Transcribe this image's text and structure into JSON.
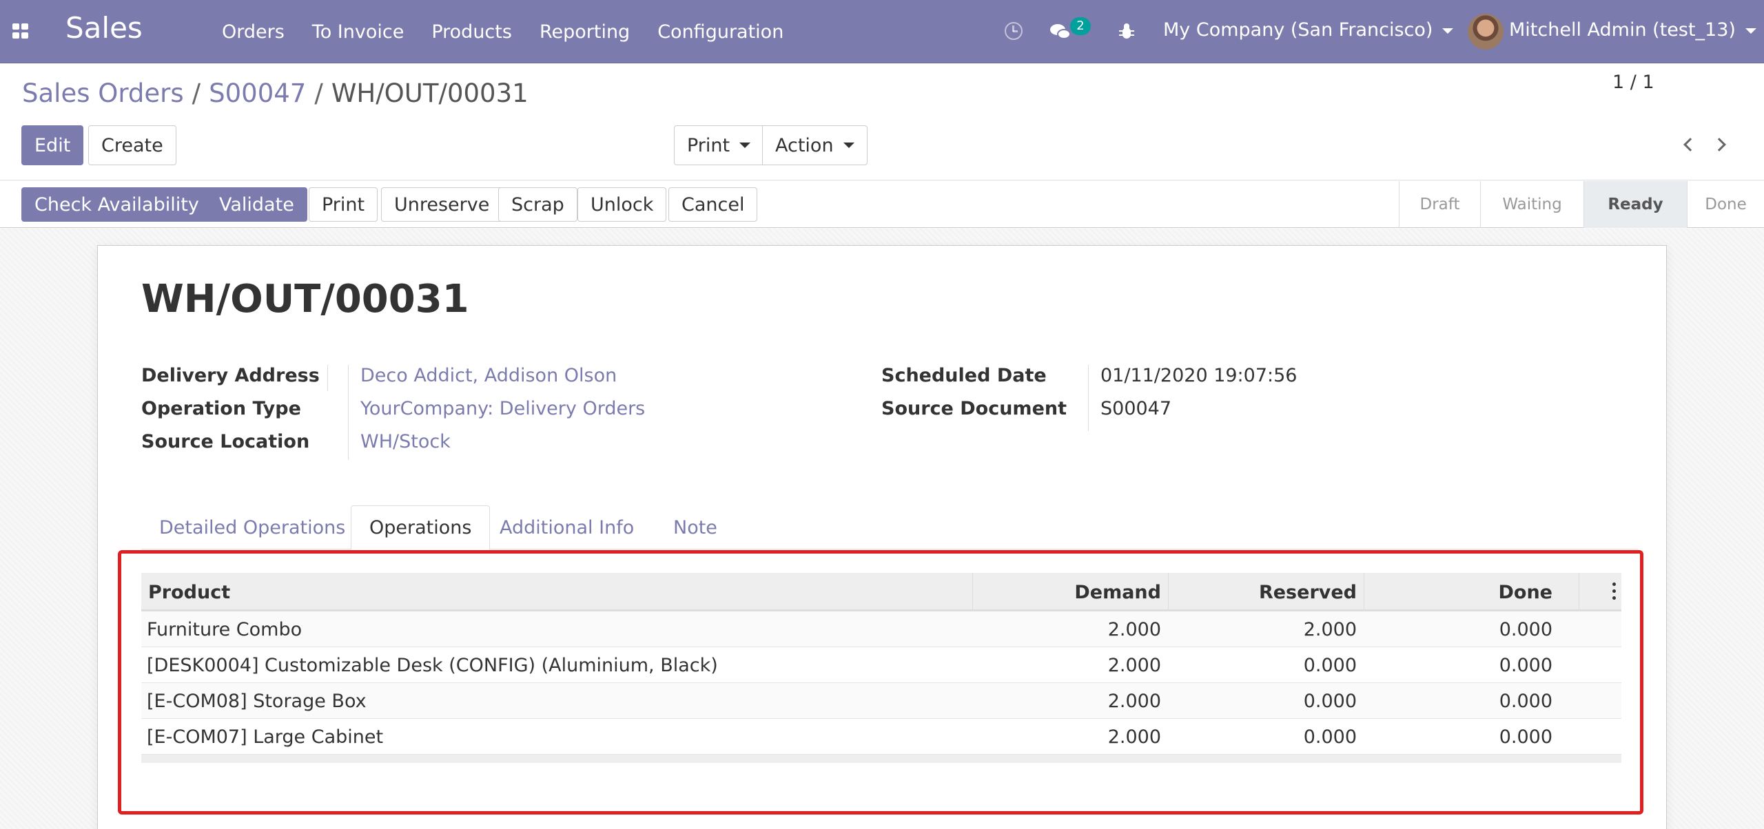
{
  "navbar": {
    "app_name": "Sales",
    "menu": [
      "Orders",
      "To Invoice",
      "Products",
      "Reporting",
      "Configuration"
    ],
    "messages_count": "2",
    "company": "My Company (San Francisco)",
    "user": "Mitchell Admin (test_13)"
  },
  "breadcrumb": {
    "level1": "Sales Orders",
    "level2": "S00047",
    "current": "WH/OUT/00031",
    "separator": "/"
  },
  "controls": {
    "edit": "Edit",
    "create": "Create",
    "print": "Print",
    "action": "Action",
    "pager": "1 / 1"
  },
  "statusbar": {
    "buttons": [
      "Check Availability",
      "Validate",
      "Print",
      "Unreserve",
      "Scrap",
      "Unlock",
      "Cancel"
    ],
    "stages": [
      "Draft",
      "Waiting",
      "Ready",
      "Done"
    ],
    "active_stage": "Ready"
  },
  "record": {
    "title": "WH/OUT/00031",
    "delivery_address_label": "Delivery Address",
    "delivery_address": "Deco Addict, Addison Olson",
    "operation_type_label": "Operation Type",
    "operation_type": "YourCompany: Delivery Orders",
    "source_location_label": "Source Location",
    "source_location": "WH/Stock",
    "scheduled_date_label": "Scheduled Date",
    "scheduled_date": "01/11/2020 19:07:56",
    "source_document_label": "Source Document",
    "source_document": "S00047"
  },
  "tabs": [
    "Detailed Operations",
    "Operations",
    "Additional Info",
    "Note"
  ],
  "active_tab": "Operations",
  "operations_table": {
    "columns": [
      "Product",
      "Demand",
      "Reserved",
      "Done"
    ],
    "rows": [
      [
        "Furniture Combo",
        "2.000",
        "2.000",
        "0.000"
      ],
      [
        "[DESK0004] Customizable Desk (CONFIG) (Aluminium, Black)",
        "2.000",
        "0.000",
        "0.000"
      ],
      [
        "[E-COM08] Storage Box",
        "2.000",
        "0.000",
        "0.000"
      ],
      [
        "[E-COM07] Large Cabinet",
        "2.000",
        "0.000",
        "0.000"
      ]
    ]
  },
  "colors": {
    "brand": "#7c7bad",
    "badge": "#00a09d",
    "highlight": "#e02020"
  }
}
